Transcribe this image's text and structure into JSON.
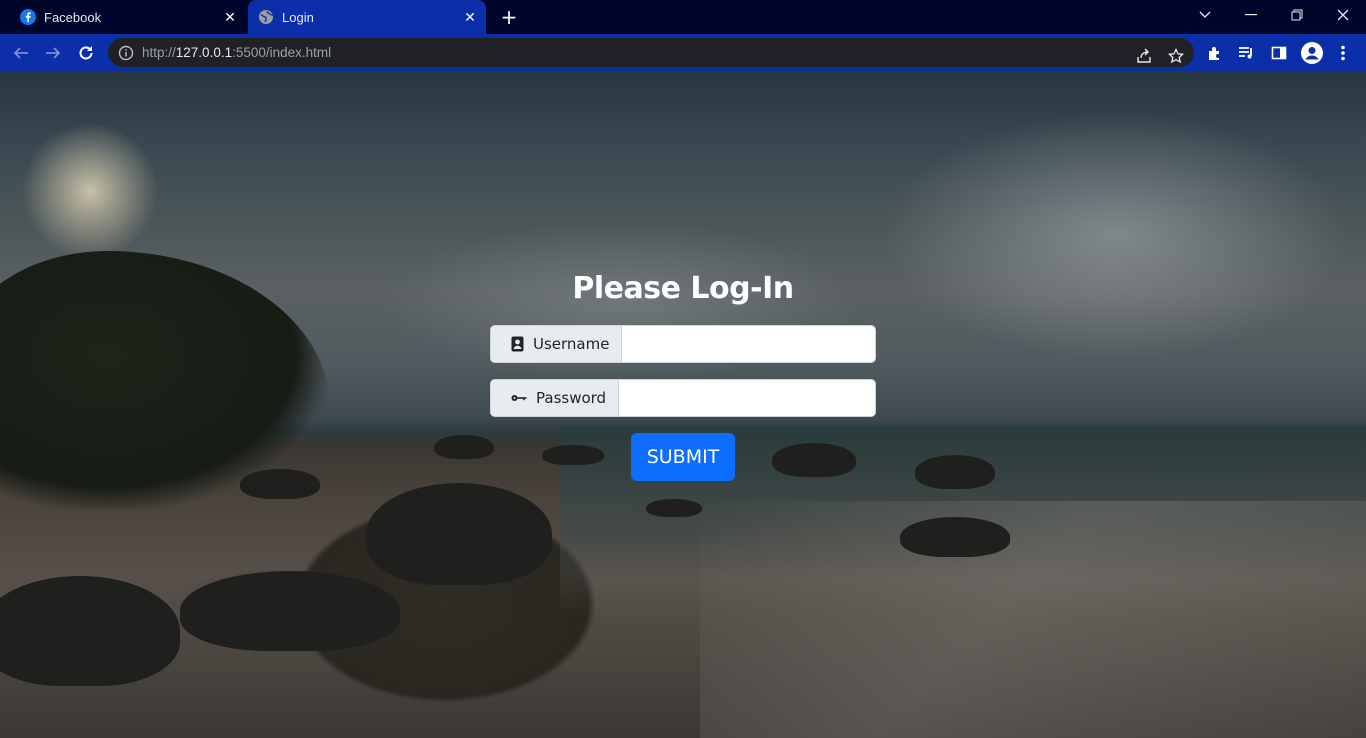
{
  "browser": {
    "tabs": [
      {
        "title": "Facebook",
        "icon": "facebook-icon",
        "active": false
      },
      {
        "title": "Login",
        "icon": "globe-icon",
        "active": true
      }
    ],
    "address": {
      "scheme": "http://",
      "host": "127.0.0.1",
      "rest": ":5500/index.html"
    },
    "colors": {
      "tabstrip": "#00052b",
      "toolbar": "#0a2fa8",
      "omnibox": "#202124"
    }
  },
  "login": {
    "title": "Please Log-In",
    "username_label": "Username",
    "username_icon": "user-badge-icon",
    "username_value": "",
    "password_label": "Password",
    "password_icon": "key-icon",
    "password_value": "",
    "submit_label": "SUBMIT",
    "submit_color": "#0d6efd"
  }
}
